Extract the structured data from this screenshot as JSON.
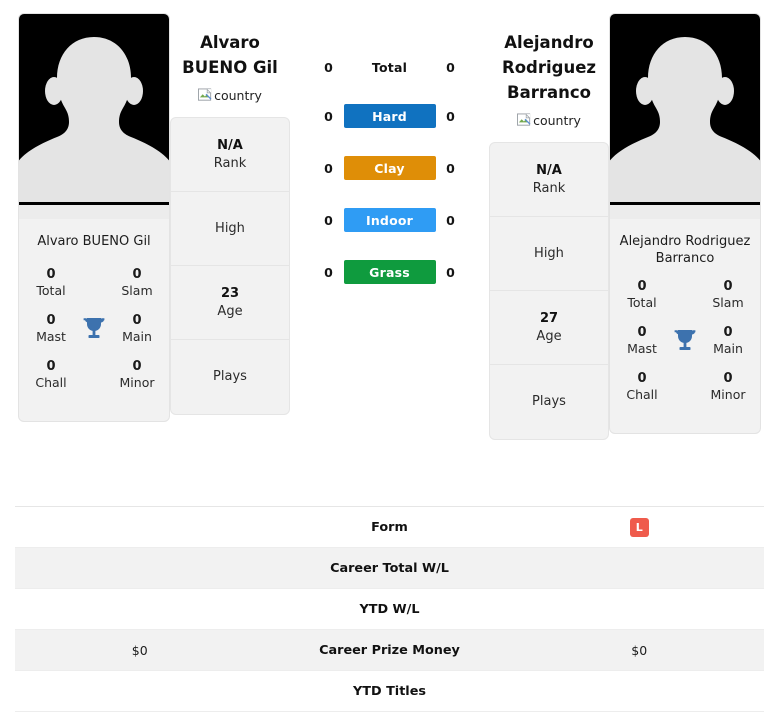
{
  "players": {
    "left": {
      "display_name": "Alvaro\nBUENO Gil",
      "name_line1": "Alvaro",
      "name_line2": "BUENO Gil",
      "photo_caption": "Alvaro BUENO Gil",
      "country_alt": "country",
      "titles": [
        {
          "value": "0",
          "label": "Total"
        },
        {
          "value": "0",
          "label": "Slam"
        },
        {
          "value": "0",
          "label": "Mast"
        },
        {
          "value": "0",
          "label": "Main"
        },
        {
          "value": "0",
          "label": "Chall"
        },
        {
          "value": "0",
          "label": "Minor"
        }
      ],
      "info": [
        {
          "value": "N/A",
          "label": "Rank"
        },
        {
          "value": "",
          "label": "High"
        },
        {
          "value": "23",
          "label": "Age"
        },
        {
          "value": "",
          "label": "Plays"
        }
      ]
    },
    "right": {
      "name_line1": "Alejandro",
      "name_line2": "Rodriguez",
      "name_line3": "Barranco",
      "photo_caption": "Alejandro Rodriguez Barranco",
      "country_alt": "country",
      "titles": [
        {
          "value": "0",
          "label": "Total"
        },
        {
          "value": "0",
          "label": "Slam"
        },
        {
          "value": "0",
          "label": "Mast"
        },
        {
          "value": "0",
          "label": "Main"
        },
        {
          "value": "0",
          "label": "Chall"
        },
        {
          "value": "0",
          "label": "Minor"
        }
      ],
      "info": [
        {
          "value": "N/A",
          "label": "Rank"
        },
        {
          "value": "",
          "label": "High"
        },
        {
          "value": "27",
          "label": "Age"
        },
        {
          "value": "",
          "label": "Plays"
        }
      ]
    }
  },
  "surfaces": [
    {
      "label": "Total",
      "left": "0",
      "right": "0",
      "color": "transparent",
      "text_color": "#111111",
      "plain": true
    },
    {
      "label": "Hard",
      "left": "0",
      "right": "0",
      "color": "#1072c0",
      "text_color": "#ffffff",
      "plain": false
    },
    {
      "label": "Clay",
      "left": "0",
      "right": "0",
      "color": "#df8e07",
      "text_color": "#ffffff",
      "plain": false
    },
    {
      "label": "Indoor",
      "left": "0",
      "right": "0",
      "color": "#2f9cf4",
      "text_color": "#ffffff",
      "plain": false
    },
    {
      "label": "Grass",
      "left": "0",
      "right": "0",
      "color": "#0f9b3e",
      "text_color": "#ffffff",
      "plain": false
    }
  ],
  "table": [
    {
      "left": "",
      "label": "Form",
      "right": "L",
      "right_is_badge": true,
      "badge_color": "#ef5b4c",
      "striped": false
    },
    {
      "left": "",
      "label": "Career Total W/L",
      "right": "",
      "right_is_badge": false,
      "striped": true
    },
    {
      "left": "",
      "label": "YTD W/L",
      "right": "",
      "right_is_badge": false,
      "striped": false
    },
    {
      "left": "$0",
      "label": "Career Prize Money",
      "right": "$0",
      "right_is_badge": false,
      "striped": true
    },
    {
      "left": "",
      "label": "YTD Titles",
      "right": "",
      "right_is_badge": false,
      "striped": false
    }
  ],
  "colors": {
    "card_bg": "#f2f2f2",
    "trophy": "#3d72ae",
    "form_loss": "#ef5b4c"
  },
  "icons": {
    "trophy": "trophy-icon",
    "broken_image": "broken-image-icon",
    "avatar": "avatar-silhouette-icon"
  }
}
